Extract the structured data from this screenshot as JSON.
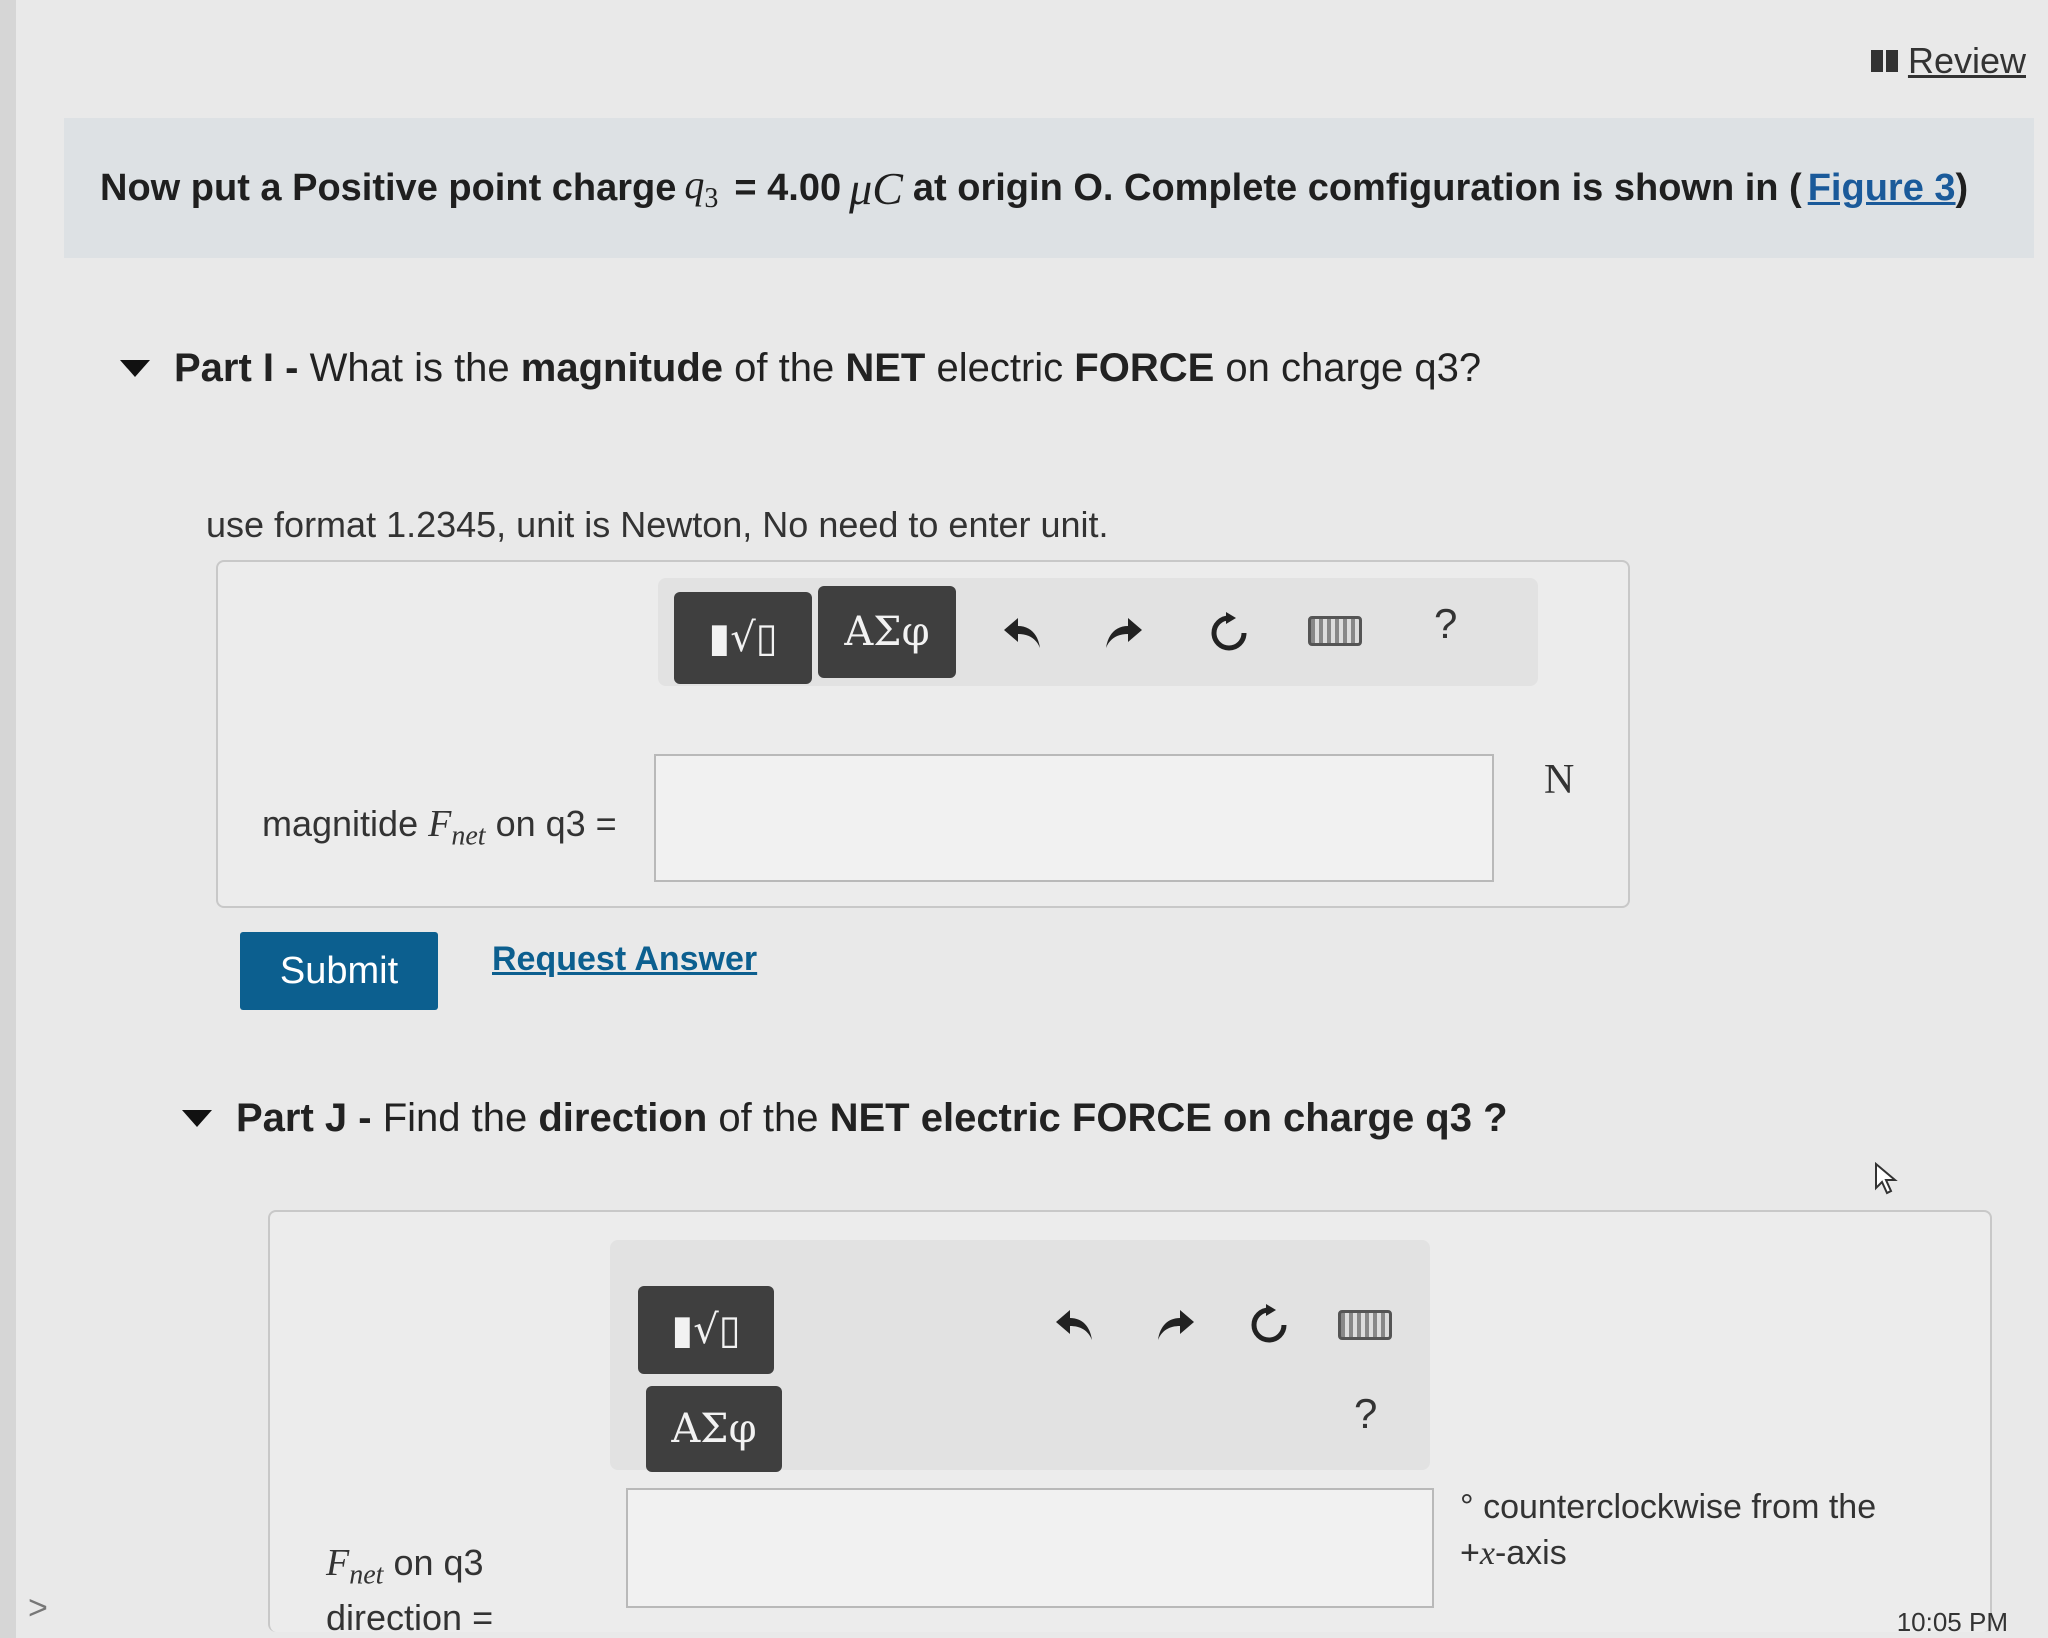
{
  "review": {
    "label": "Review"
  },
  "intro": {
    "text_before": "Now put a Positive point charge",
    "var_symbol": "q",
    "var_sub": "3",
    "value": "= 4.00",
    "unit": "μC",
    "text_after": "at origin O. Complete comfiguration is shown in (",
    "figure_link": "Figure 3",
    "close_paren": ")"
  },
  "part_i": {
    "label": "Part I",
    "sep": " - ",
    "q1": "What is the ",
    "b1": "magnitude",
    "q2": " of the ",
    "b2": "NET",
    "q3": " electric ",
    "b3": "FORCE",
    "q4": " on charge q3?",
    "hint": "use format 1.2345, unit is Newton, No need to enter unit.",
    "toolbar": {
      "template_btn": "▮√▯",
      "greek_btn": "ΑΣφ",
      "help": "?"
    },
    "field_label_prefix": "magnitide",
    "field_var": "F",
    "field_var_sub": "net",
    "field_label_suffix": "on q3 =",
    "input_value": "",
    "unit": "N"
  },
  "actions": {
    "submit": "Submit",
    "request_answer": "Request Answer"
  },
  "part_j": {
    "label": "Part J",
    "sep": " - ",
    "q1": "Find the ",
    "b1": "direction",
    "q2": " of the ",
    "b2": "NET electric FORCE on charge q3 ?",
    "toolbar": {
      "template_btn": "▮√▯",
      "greek_btn": "ΑΣφ",
      "help": "?"
    },
    "field_var": "F",
    "field_var_sub": "net",
    "field_label_line1": "on q3",
    "field_label_line2": "direction =",
    "input_value": "",
    "suffix_degree": "°",
    "suffix_line1": "counterclockwise from the",
    "suffix_plus": "+",
    "suffix_var": "x",
    "suffix_axis": "-axis"
  },
  "clock": "10:05 PM",
  "left_chevron": ">"
}
